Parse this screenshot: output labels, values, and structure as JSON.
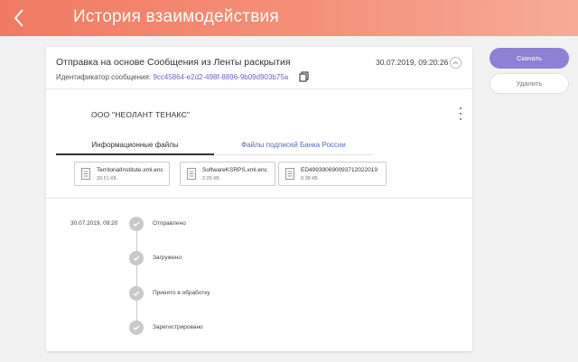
{
  "header": {
    "title": "История взаимодействия"
  },
  "message": {
    "title": "Отправка на основе Сообщения из Ленты раскрытия",
    "date": "30.07.2019, 09:20:26",
    "id_label": "Идентификатор сообщения:",
    "id_value": "9cc45864-e2d2-498f-8896-9b09d903b75a"
  },
  "organization": "ООО \"НЕОЛАНТ ТЕНАКС\"",
  "tabs": [
    {
      "label": "Информационные файлы",
      "active": true
    },
    {
      "label": "Файлы подписей Банка России",
      "active": false
    }
  ],
  "files": [
    {
      "name": "TerritorialInstitute.xml.enc",
      "size": "33.51 КБ"
    },
    {
      "name": "SoftwareKSRPS.xml.enc",
      "size": "2.25 КБ"
    },
    {
      "name": "ED499390690093712022019",
      "size": "0.38 КБ"
    }
  ],
  "timeline": {
    "date": "30.07.2019, 09:20",
    "steps": [
      "Отправлено",
      "Загружено",
      "Принято в обработку",
      "Зарегистрировано"
    ]
  },
  "actions": {
    "download": "Скачать",
    "delete": "Удалить"
  },
  "colors": {
    "header_start": "#f07a61",
    "accent": "#8e80d4",
    "link": "#6b62c9"
  },
  "icons": {
    "back": "chevron-left-icon",
    "collapse": "chevron-up-icon",
    "copy": "copy-icon",
    "more": "more-vert-icon",
    "file": "document-icon",
    "check": "check-icon"
  }
}
